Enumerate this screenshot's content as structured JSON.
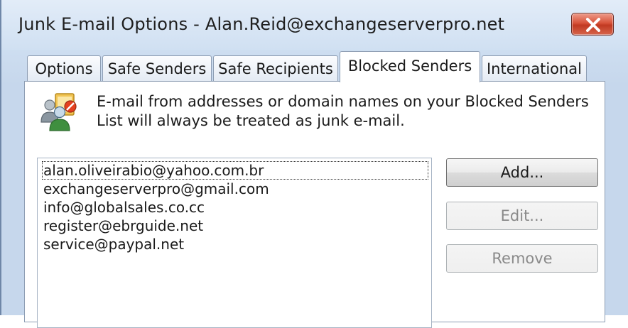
{
  "window": {
    "title": "Junk E-mail Options - Alan.Reid@exchangeserverpro.net",
    "close_icon": "close-x-icon"
  },
  "tabs": [
    {
      "label": "Options",
      "active": false
    },
    {
      "label": "Safe Senders",
      "active": false
    },
    {
      "label": "Safe Recipients",
      "active": false
    },
    {
      "label": "Blocked Senders",
      "active": true
    },
    {
      "label": "International",
      "active": false
    }
  ],
  "panel": {
    "icon": "blocked-senders-people-icon",
    "description_line1": "E-mail from addresses or domain names on your Blocked Senders",
    "description_line2": "List will always be treated as junk e-mail."
  },
  "blocked_list": {
    "items": [
      "alan.oliveirabio@yahoo.com.br",
      "exchangeserverpro@gmail.com",
      "info@globalsales.co.cc",
      "register@ebrguide.net",
      "service@paypal.net"
    ],
    "focused_index": 0
  },
  "buttons": {
    "add": "Add...",
    "edit": "Edit...",
    "remove": "Remove"
  },
  "colors": {
    "close_button": "#d8533a",
    "panel_background": "#ffffff",
    "window_frame": "#cfdff1"
  }
}
